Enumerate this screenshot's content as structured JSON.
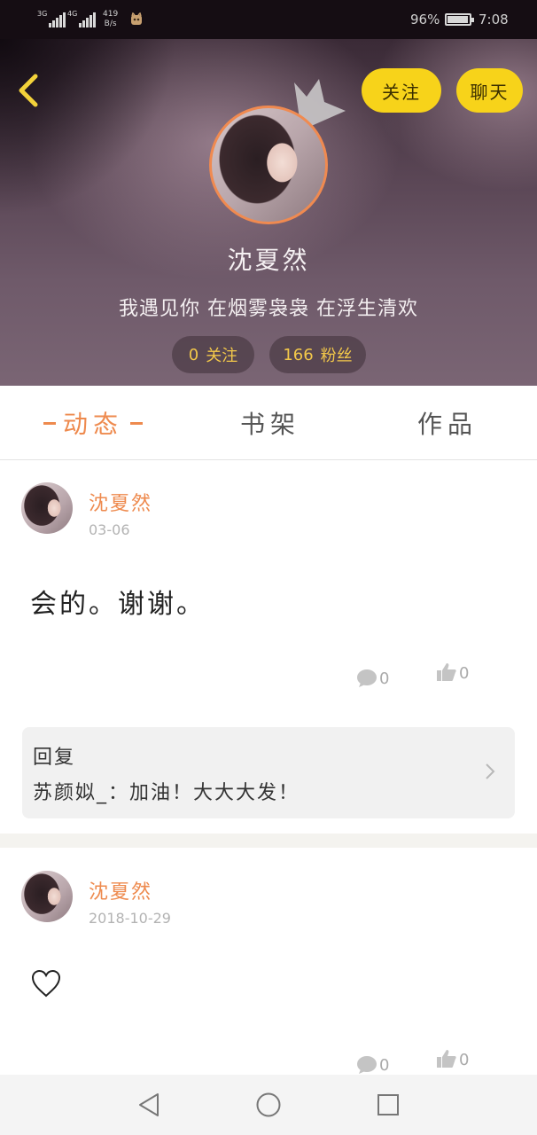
{
  "status_bar": {
    "net1": "3G",
    "net2": "4G",
    "speed_value": "419",
    "speed_unit": "B/s",
    "battery_percent": "96%",
    "battery_level": 0.96,
    "time": "7:08"
  },
  "profile": {
    "name": "沈夏然",
    "signature": "我遇见你 在烟雾袅袅 在浮生清欢",
    "follow_button": "关注",
    "chat_button": "聊天",
    "following_count": "0",
    "following_label": "关注",
    "fans_count": "166",
    "fans_label": "粉丝"
  },
  "tabs": [
    {
      "label": "动态",
      "active": true
    },
    {
      "label": "书架",
      "active": false
    },
    {
      "label": "作品",
      "active": false
    }
  ],
  "posts": [
    {
      "author": "沈夏然",
      "date": "03-06",
      "text": "会的。谢谢。",
      "comment_count": "0",
      "like_count": "0",
      "reply": {
        "title": "回复",
        "text": "苏颜姒_：加油！大大大发！"
      }
    },
    {
      "author": "沈夏然",
      "date": "2018-10-29",
      "icon": "heart-outline-icon",
      "comment_count": "0",
      "like_count": "0"
    }
  ],
  "colors": {
    "accent": "#ee8a4e",
    "button_yellow": "#f7d31a",
    "stat_text": "#f3c84a"
  }
}
